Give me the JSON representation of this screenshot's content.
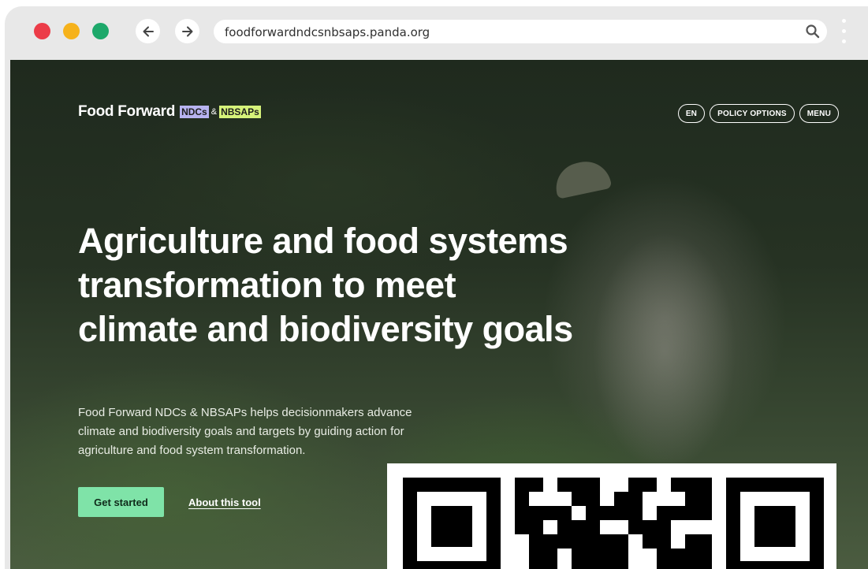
{
  "browser": {
    "url": "foodforwardndcsnbsaps.panda.org",
    "icons": {
      "back": "arrow-left-icon",
      "forward": "arrow-right-icon",
      "search": "search-icon",
      "menu": "kebab-menu-icon"
    }
  },
  "site": {
    "logo": {
      "main": "Food Forward",
      "tag1": "NDCs",
      "amp": "&",
      "tag2": "NBSAPs"
    },
    "nav": {
      "lang": "EN",
      "policy": "POLICY OPTIONS",
      "menu": "MENU"
    },
    "hero": {
      "headline": "Agriculture and food systems transformation to meet climate and biodiversity goals",
      "description": "Food Forward NDCs & NBSAPs helps decisionmakers advance climate and biodiversity goals and targets by guiding action for agriculture and food system transformation.",
      "cta": "Get started",
      "secondary": "About this tool"
    }
  },
  "colors": {
    "accent_green": "#7fe3a8",
    "tag_purple": "#b7b3f0",
    "tag_lime": "#d6f27a"
  }
}
